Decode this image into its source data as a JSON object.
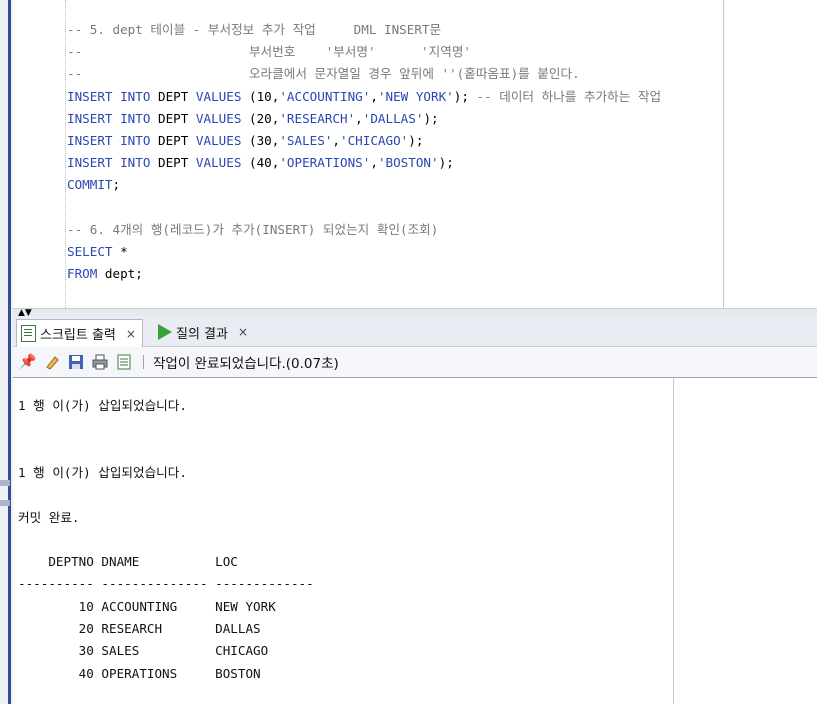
{
  "editor": {
    "lines": [
      {
        "parts": [
          {
            "t": "-- 5. dept 테이블 - 부서정보 추가 작업     DML INSERT문",
            "c": "c-comment"
          }
        ]
      },
      {
        "parts": [
          {
            "t": "--                      부서번호    '부서명'      '지역명'",
            "c": "c-comment"
          }
        ]
      },
      {
        "parts": [
          {
            "t": "--                      오라클에서 문자열일 경우 앞뒤에 ''(홑따옴표)를 붙인다.",
            "c": "c-comment"
          }
        ]
      },
      {
        "parts": [
          {
            "t": "INSERT INTO ",
            "c": "c-kw"
          },
          {
            "t": "DEPT ",
            "c": "c-plain"
          },
          {
            "t": "VALUES ",
            "c": "c-kw"
          },
          {
            "t": "(10,",
            "c": "c-plain"
          },
          {
            "t": "'ACCOUNTING'",
            "c": "c-str"
          },
          {
            "t": ",",
            "c": "c-plain"
          },
          {
            "t": "'NEW YORK'",
            "c": "c-str"
          },
          {
            "t": "); ",
            "c": "c-plain"
          },
          {
            "t": "-- 데이터 하나를 추가하는 작업",
            "c": "c-comment"
          }
        ]
      },
      {
        "parts": [
          {
            "t": "INSERT INTO ",
            "c": "c-kw"
          },
          {
            "t": "DEPT ",
            "c": "c-plain"
          },
          {
            "t": "VALUES ",
            "c": "c-kw"
          },
          {
            "t": "(20,",
            "c": "c-plain"
          },
          {
            "t": "'RESEARCH'",
            "c": "c-str"
          },
          {
            "t": ",",
            "c": "c-plain"
          },
          {
            "t": "'DALLAS'",
            "c": "c-str"
          },
          {
            "t": ");",
            "c": "c-plain"
          }
        ]
      },
      {
        "parts": [
          {
            "t": "INSERT INTO ",
            "c": "c-kw"
          },
          {
            "t": "DEPT ",
            "c": "c-plain"
          },
          {
            "t": "VALUES ",
            "c": "c-kw"
          },
          {
            "t": "(30,",
            "c": "c-plain"
          },
          {
            "t": "'SALES'",
            "c": "c-str"
          },
          {
            "t": ",",
            "c": "c-plain"
          },
          {
            "t": "'CHICAGO'",
            "c": "c-str"
          },
          {
            "t": ");",
            "c": "c-plain"
          }
        ]
      },
      {
        "parts": [
          {
            "t": "INSERT INTO ",
            "c": "c-kw"
          },
          {
            "t": "DEPT ",
            "c": "c-plain"
          },
          {
            "t": "VALUES ",
            "c": "c-kw"
          },
          {
            "t": "(40,",
            "c": "c-plain"
          },
          {
            "t": "'OPERATIONS'",
            "c": "c-str"
          },
          {
            "t": ",",
            "c": "c-plain"
          },
          {
            "t": "'BOSTON'",
            "c": "c-str"
          },
          {
            "t": ");",
            "c": "c-plain"
          }
        ]
      },
      {
        "parts": [
          {
            "t": "COMMIT",
            "c": "c-kw"
          },
          {
            "t": ";",
            "c": "c-plain"
          }
        ]
      },
      {
        "parts": []
      },
      {
        "parts": [
          {
            "t": "-- 6. 4개의 행(레코드)가 추가(INSERT) 되었는지 확인(조회)",
            "c": "c-comment"
          }
        ]
      },
      {
        "parts": [
          {
            "t": "SELECT ",
            "c": "c-kw"
          },
          {
            "t": "*",
            "c": "c-plain"
          }
        ]
      },
      {
        "parts": [
          {
            "t": "FROM ",
            "c": "c-kw"
          },
          {
            "t": "dept;",
            "c": "c-plain"
          }
        ]
      }
    ]
  },
  "tabs": [
    {
      "label": "스크립트 출력",
      "close": "×",
      "icon": "script-output-icon"
    },
    {
      "label": "질의 결과",
      "close": "×",
      "icon": "run-query-icon"
    }
  ],
  "toolbar": {
    "status": "작업이 완료되었습니다.(0.07초)",
    "icons": [
      "pin-icon",
      "eraser-icon",
      "save-icon",
      "print-icon",
      "document-icon"
    ]
  },
  "output": {
    "lines": [
      "1 행 이(가) 삽입되었습니다.",
      "",
      "",
      "1 행 이(가) 삽입되었습니다.",
      "",
      "커밋 완료.",
      "",
      "    DEPTNO DNAME          LOC",
      "---------- -------------- -------------",
      "        10 ACCOUNTING     NEW YORK",
      "        20 RESEARCH       DALLAS",
      "        30 SALES          CHICAGO",
      "        40 OPERATIONS     BOSTON"
    ]
  },
  "colors": {
    "accent": "#2e4f9c",
    "keyword": "#2a45b5",
    "comment": "#7a7a7a"
  }
}
